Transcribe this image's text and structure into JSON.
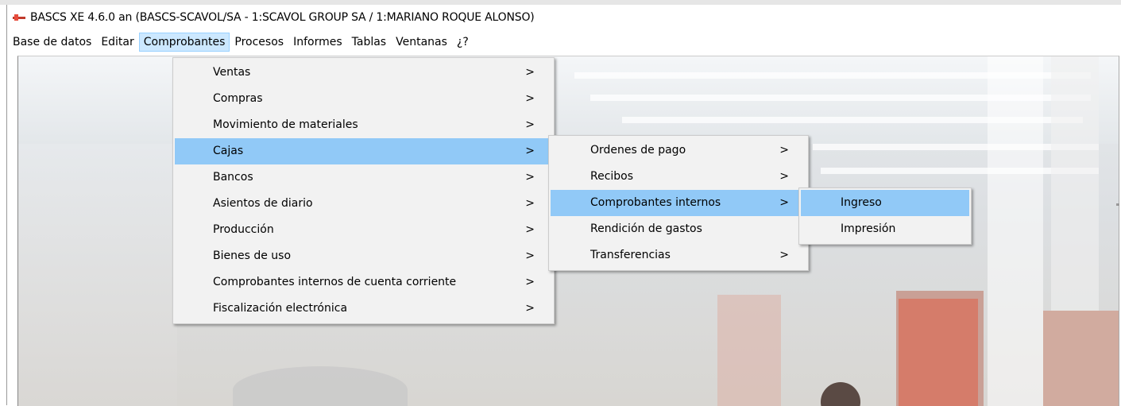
{
  "window": {
    "title": "BASCS XE 4.6.0 an (BASCS-SCAVOL/SA - 1:SCAVOL GROUP SA / 1:MARIANO ROQUE ALONSO)"
  },
  "menubar": [
    {
      "label": "Base de datos"
    },
    {
      "label": "Editar"
    },
    {
      "label": "Comprobantes",
      "active": true
    },
    {
      "label": "Procesos"
    },
    {
      "label": "Informes"
    },
    {
      "label": "Tablas"
    },
    {
      "label": "Ventanas"
    },
    {
      "label": "¿?"
    }
  ],
  "comprobantes_menu": [
    {
      "label": "Ventas",
      "arrow": ">"
    },
    {
      "label": "Compras",
      "arrow": ">"
    },
    {
      "label": "Movimiento de materiales",
      "arrow": ">"
    },
    {
      "label": "Cajas",
      "arrow": ">",
      "highlighted": true
    },
    {
      "label": "Bancos",
      "arrow": ">"
    },
    {
      "label": "Asientos de diario",
      "arrow": ">"
    },
    {
      "label": "Producción",
      "arrow": ">"
    },
    {
      "label": "Bienes de uso",
      "arrow": ">"
    },
    {
      "label": "Comprobantes internos de cuenta corriente",
      "arrow": ">"
    },
    {
      "label": "Fiscalización electrónica",
      "arrow": ">"
    }
  ],
  "cajas_menu": [
    {
      "label": "Ordenes de pago",
      "arrow": ">"
    },
    {
      "label": "Recibos",
      "arrow": ">"
    },
    {
      "label": "Comprobantes internos",
      "arrow": ">",
      "highlighted": true
    },
    {
      "label": "Rendición de gastos"
    },
    {
      "label": "Transferencias",
      "arrow": ">"
    }
  ],
  "comprobantes_internos_menu": [
    {
      "label": "Ingreso",
      "highlighted": true
    },
    {
      "label": "Impresión"
    }
  ],
  "colors": {
    "highlight": "#91c9f7",
    "menu_bg": "#f2f2f2",
    "menubar_active": "#cce8ff"
  }
}
